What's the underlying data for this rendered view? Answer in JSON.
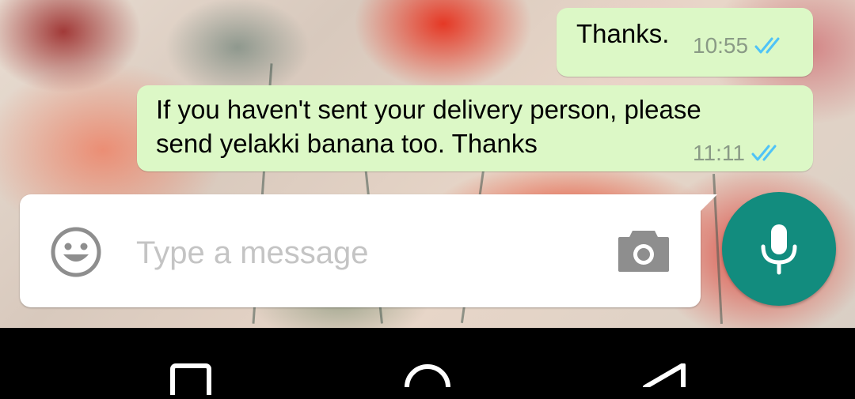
{
  "messages": [
    {
      "text": "Thanks.",
      "time": "10:55",
      "status": "read-double-check"
    },
    {
      "line1": "If you haven't sent your delivery person, please",
      "line2": "send yelakki banana too. Thanks",
      "time": "11:11",
      "status": "read-double-check"
    }
  ],
  "composer": {
    "placeholder": "Type a message",
    "emoji_icon": "smiley-icon",
    "camera_icon": "camera-icon",
    "mic_icon": "microphone-icon"
  },
  "navbar": {
    "back_icon": "back-triangle-icon",
    "home_icon": "home-circle-icon",
    "recents_icon": "recents-square-icon"
  },
  "colors": {
    "outgoing_bubble": "#dcf8c6",
    "mic_button": "#128c7e",
    "read_ticks": "#4fc3f7",
    "timestamp": "#8a9a86"
  }
}
